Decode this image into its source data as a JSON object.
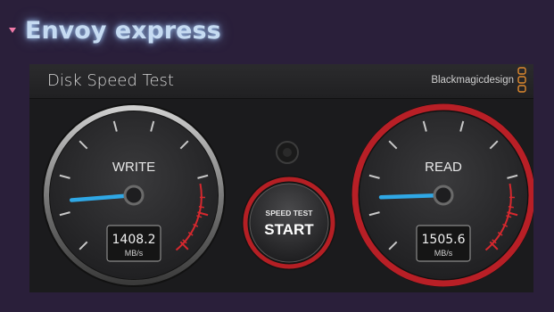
{
  "heading": {
    "title": "Envoy express"
  },
  "app": {
    "title": "Disk Speed Test",
    "brand": "Blackmagicdesign",
    "start_label_top": "SPEED TEST",
    "start_label_main": "START"
  },
  "gauges": {
    "write": {
      "label": "WRITE",
      "value": "1408.2",
      "unit": "MB/s",
      "needle_fraction": 0.15
    },
    "read": {
      "label": "READ",
      "value": "1505.6",
      "unit": "MB/s",
      "needle_fraction": 0.16
    }
  },
  "colors": {
    "accent_needle": "#2fa8e6",
    "warning_red": "#d6282e",
    "heading_glow": "#c6dbf2"
  }
}
